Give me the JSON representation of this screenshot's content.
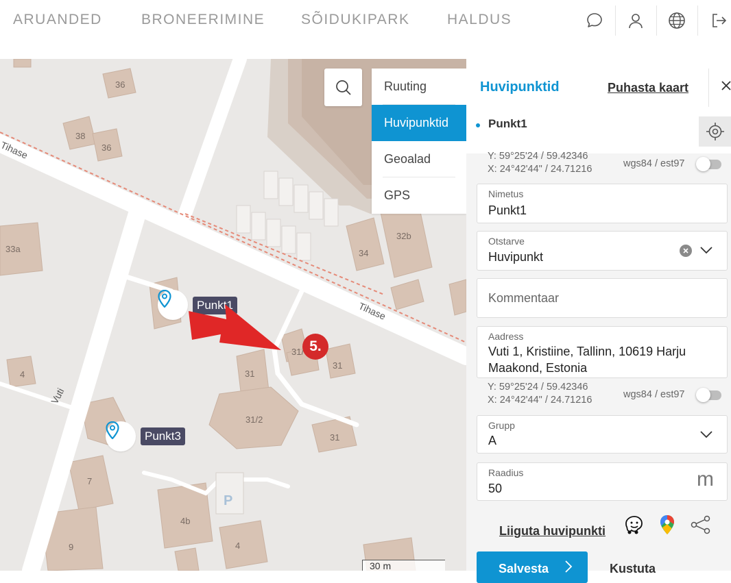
{
  "nav": {
    "items": [
      {
        "label": "ARUANDED"
      },
      {
        "label": "BRONEERIMINE"
      },
      {
        "label": "SÕIDUKIPARK"
      },
      {
        "label": "HALDUS"
      }
    ],
    "icons": [
      "chat-icon",
      "user-icon",
      "globe-icon",
      "logout-icon"
    ]
  },
  "map": {
    "streets": [
      "Tihase",
      "Tihase",
      "Vuti"
    ],
    "buildings": [
      "36",
      "38",
      "36",
      "33a",
      "34",
      "32b",
      "31/",
      "31",
      "31",
      "4",
      "31/2",
      "31",
      "7",
      "4b",
      "9",
      "4"
    ],
    "parking": "P",
    "scale": "30 m",
    "pins": [
      {
        "label": "Punkt1"
      },
      {
        "label": "Punkt3"
      }
    ],
    "step_badge": "5."
  },
  "side_menu": {
    "items": [
      {
        "label": "Ruuting"
      },
      {
        "label": "Huvipunktid"
      },
      {
        "label": "Geoalad"
      },
      {
        "label": "GPS"
      }
    ]
  },
  "panel": {
    "title": "Huvipunktid",
    "clear_map": "Puhasta kaart",
    "point_name": "Punkt1",
    "coords_y": "Y: 59°25'24 / 59.42346",
    "coords_x": "X: 24°42'44\" / 24.71216",
    "coord_system": "wgs84 / est97",
    "name_field": {
      "label": "Nimetus",
      "value": "Punkt1"
    },
    "type_field": {
      "label": "Otstarve",
      "value": "Huvipunkt"
    },
    "comment_field": {
      "placeholder": "Kommentaar"
    },
    "address_field": {
      "label": "Aadress",
      "value_line1": "Vuti 1, Kristiine, Tallinn, 10619 Harju",
      "value_line2": "Maakond, Estonia"
    },
    "address_coords_y": "Y: 59°25'24 / 59.42346",
    "address_coords_x": "X: 24°42'44\" / 24.71216",
    "address_coord_system": "wgs84 / est97",
    "group_field": {
      "label": "Grupp",
      "value": "A"
    },
    "radius_field": {
      "label": "Raadius",
      "value": "50",
      "unit": "m"
    },
    "move_link": "Liiguta huvipunkti",
    "save_button": "Salvesta",
    "delete_button": "Kustuta"
  },
  "colors": {
    "accent": "#0f94d2",
    "badge_red": "#d42a2a",
    "pin_label_bg": "#4a4a64"
  }
}
